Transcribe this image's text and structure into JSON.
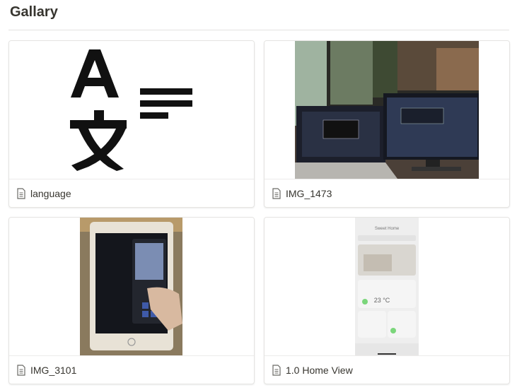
{
  "page": {
    "title": "Gallary"
  },
  "cards": [
    {
      "label": "language",
      "icon": "page-icon"
    },
    {
      "label": "IMG_1473",
      "icon": "page-icon"
    },
    {
      "label": "IMG_3101",
      "icon": "page-icon"
    },
    {
      "label": "1.0 Home View",
      "icon": "page-icon"
    }
  ],
  "home_view_screen": {
    "app_title": "Sweet Home",
    "temperature": "23 °C"
  },
  "colors": {
    "text": "#37352f",
    "border": "#e5e4e2",
    "divider": "#e3e2e0"
  }
}
